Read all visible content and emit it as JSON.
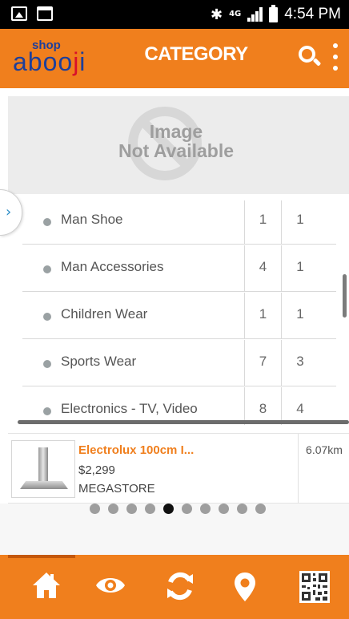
{
  "status_bar": {
    "network": "4G",
    "time": "4:54 PM"
  },
  "app_bar": {
    "logo_small": "shop",
    "logo_main": "abooji",
    "title": "CATEGORY"
  },
  "placeholder_image": {
    "line1": "Image",
    "line2": "Not Available"
  },
  "categories": [
    {
      "name": "Man Shoe",
      "col1": "1",
      "col2": "1"
    },
    {
      "name": "Man Accessories",
      "col1": "4",
      "col2": "1"
    },
    {
      "name": "Children Wear",
      "col1": "1",
      "col2": "1"
    },
    {
      "name": "Sports Wear",
      "col1": "7",
      "col2": "3"
    },
    {
      "name": "Electronics - TV, Video",
      "col1": "8",
      "col2": "4"
    }
  ],
  "product": {
    "title": "Electrolux 100cm I...",
    "price": "$2,299",
    "store": "MEGASTORE",
    "distance": "6.07km"
  },
  "pager": {
    "total": 10,
    "active_index": 4
  },
  "colors": {
    "brand_orange": "#f07f1d",
    "logo_blue": "#1e3f9a",
    "logo_red": "#d8102a"
  },
  "bottom_nav": [
    {
      "icon": "home-icon"
    },
    {
      "icon": "eye-icon"
    },
    {
      "icon": "refresh-icon"
    },
    {
      "icon": "map-pin-icon"
    },
    {
      "icon": "qr-code-icon"
    }
  ]
}
